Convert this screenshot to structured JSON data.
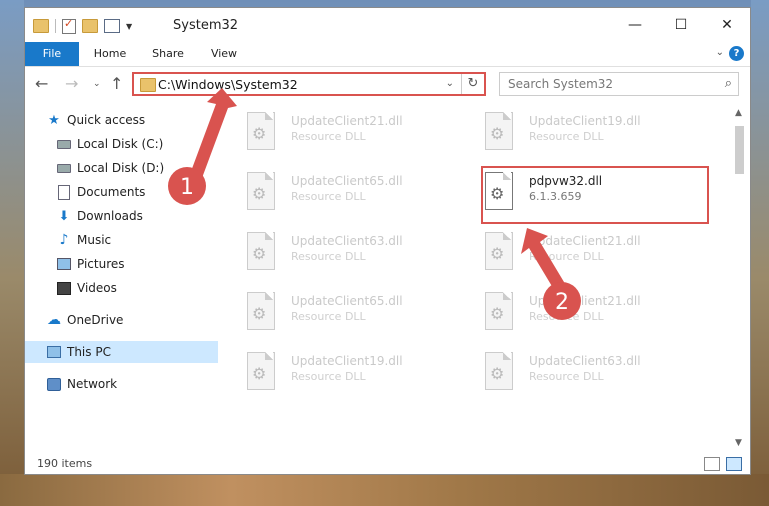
{
  "window": {
    "title": "System32",
    "controls": {
      "minimize": "—",
      "maximize": "☐",
      "close": "✕"
    }
  },
  "ribbon": {
    "tabs": [
      "File",
      "Home",
      "Share",
      "View"
    ],
    "expand": "⌄",
    "help": "?"
  },
  "address": {
    "path": "C:\\Windows\\System32",
    "dropdown": "⌄",
    "refresh": "↻"
  },
  "search": {
    "placeholder": "Search System32",
    "icon": "search-icon"
  },
  "nav": {
    "back": "←",
    "forward": "→",
    "recent": "⌄",
    "up": "↑"
  },
  "sidebar": {
    "items": [
      {
        "label": "Quick access",
        "icon": "star-icon",
        "pinned": false
      },
      {
        "label": "Local Disk (C:)",
        "icon": "disk-icon",
        "pinned": true
      },
      {
        "label": "Local Disk (D:)",
        "icon": "disk-icon",
        "pinned": true
      },
      {
        "label": "Documents",
        "icon": "documents-icon",
        "pinned": true
      },
      {
        "label": "Downloads",
        "icon": "downloads-icon",
        "pinned": true
      },
      {
        "label": "Music",
        "icon": "music-icon",
        "pinned": true
      },
      {
        "label": "Pictures",
        "icon": "pictures-icon",
        "pinned": true
      },
      {
        "label": "Videos",
        "icon": "videos-icon",
        "pinned": true
      },
      {
        "label": "OneDrive",
        "icon": "onedrive-icon",
        "pinned": false
      },
      {
        "label": "This PC",
        "icon": "this-pc-icon",
        "pinned": false,
        "selected": true
      },
      {
        "label": "Network",
        "icon": "network-icon",
        "pinned": false
      }
    ]
  },
  "files": [
    {
      "name": "UpdateClient21.dll",
      "desc": "Resource DLL"
    },
    {
      "name": "UpdateClient19.dll",
      "desc": "Resource DLL"
    },
    {
      "name": "UpdateClient65.dll",
      "desc": "Resource DLL"
    },
    {
      "name": "pdpvw32.dll",
      "desc": "6.1.3.659",
      "active": true
    },
    {
      "name": "UpdateClient63.dll",
      "desc": "Resource DLL"
    },
    {
      "name": "UpdateClient21.dll",
      "desc": "Resource DLL"
    },
    {
      "name": "UpdateClient65.dll",
      "desc": "Resource DLL"
    },
    {
      "name": "UpdateClient21.dll",
      "desc": "Resource DLL"
    },
    {
      "name": "UpdateClient19.dll",
      "desc": "Resource DLL"
    },
    {
      "name": "UpdateClient63.dll",
      "desc": "Resource DLL"
    }
  ],
  "status": {
    "item_count": "190 items"
  },
  "annotations": {
    "step1": "1",
    "step2": "2",
    "color": "#d9534f"
  }
}
